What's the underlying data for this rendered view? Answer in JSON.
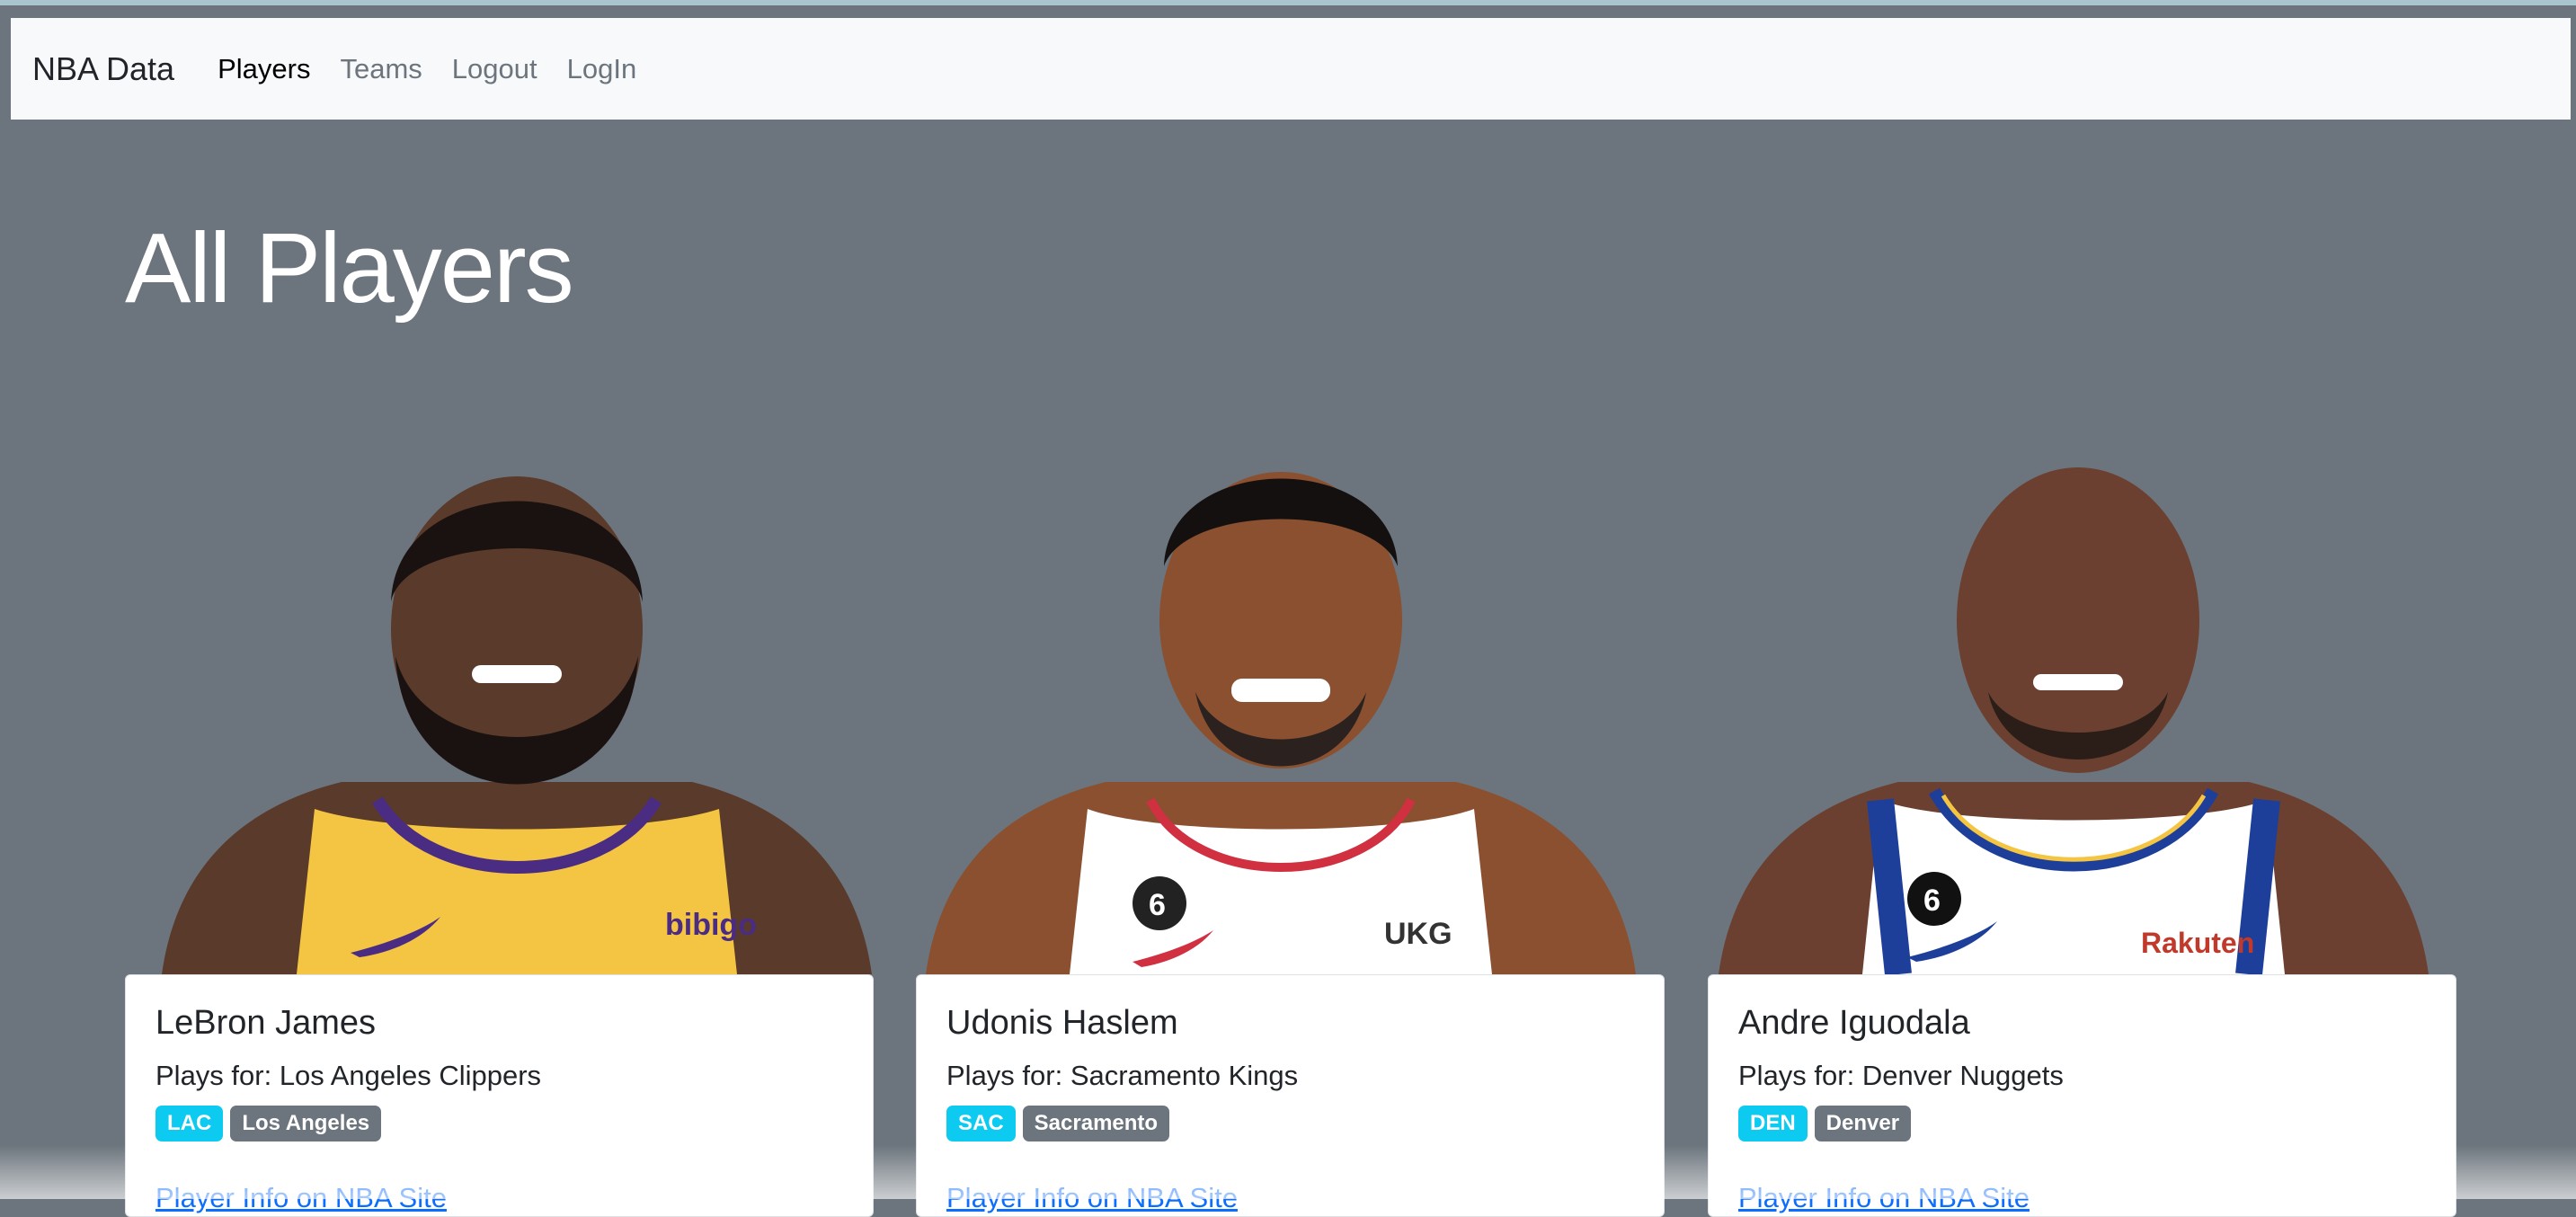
{
  "nav": {
    "brand": "NBA Data",
    "links": [
      "Players",
      "Teams",
      "Logout",
      "LogIn"
    ]
  },
  "page_title": "All Players",
  "players": [
    {
      "name": "LeBron James",
      "plays_for": "Plays for: Los Angeles Clippers",
      "abbr": "LAC",
      "city": "Los Angeles",
      "link": "Player Info on NBA Site",
      "jersey": "#f4c542",
      "trim": "#4b2c83",
      "skin": "#5a3a2a",
      "jersey_text": "bibigo"
    },
    {
      "name": "Udonis Haslem",
      "plays_for": "Plays for: Sacramento Kings",
      "abbr": "SAC",
      "city": "Sacramento",
      "link": "Player Info on NBA Site",
      "jersey": "#ffffff",
      "trim": "#d03040",
      "skin": "#8a5030",
      "jersey_text": "UKG"
    },
    {
      "name": "Andre Iguodala",
      "plays_for": "Plays for: Denver Nuggets",
      "abbr": "DEN",
      "city": "Denver",
      "link": "Player Info on NBA Site",
      "jersey": "#ffffff",
      "trim": "#1d3f9a",
      "skin": "#6b4030",
      "jersey_text": "Rakuten"
    }
  ]
}
